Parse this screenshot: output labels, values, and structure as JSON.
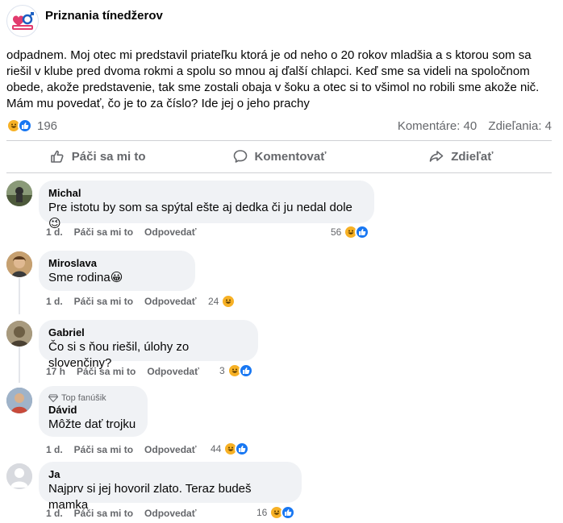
{
  "page": {
    "name": "Priznania tínedžerov",
    "logo_icon": "heart-ring-logo"
  },
  "post": {
    "text": "odpadnem. Moj otec mi predstavil priateľku ktorá je od neho o 20 rokov mladšia a s ktorou som sa riešil v klube pred dvoma rokmi a spolu so mnou aj ďalší chlapci. Keď sme sa videli na spoločnom obede, akože predstavenie, tak sme zostali obaja v šoku a otec si to všimol no robili sme akože nič. Mám mu povedať, čo je to za číslo? Ide jej o jeho prachy",
    "reactions_count": "196",
    "comments_label": "Komentáre: 40",
    "shares_label": "Zdieľania: 4"
  },
  "actions": {
    "like": "Páči sa mi to",
    "comment": "Komentovať",
    "share": "Zdieľať"
  },
  "comments": [
    {
      "name": "Michal",
      "text": "Pre istotu by som sa spýtal ešte aj dedka či ju nedal dole 😉",
      "time": "1 d.",
      "like": "Páči sa mi to",
      "reply": "Odpovedať",
      "count": "56",
      "badge": ""
    },
    {
      "name": "Miroslava",
      "text": "Sme rodina😀",
      "time": "1 d.",
      "like": "Páči sa mi to",
      "reply": "Odpovedať",
      "count": "24",
      "badge": ""
    },
    {
      "name": "Gabriel",
      "text": "Čo si s ňou riešil, úlohy zo slovenčiny?",
      "time": "17 h",
      "like": "Páči sa mi to",
      "reply": "Odpovedať",
      "count": "3",
      "badge": ""
    },
    {
      "name": "Dávid",
      "text": "Môžte dať trojku",
      "time": "1 d.",
      "like": "Páči sa mi to",
      "reply": "Odpovedať",
      "count": "44",
      "badge": "Top fanúšik"
    },
    {
      "name": "Ja",
      "text": "Najprv si jej hovoril zlato. Teraz budeš mamka",
      "time": "1 d.",
      "like": "Páči sa mi to",
      "reply": "Odpovedať",
      "count": "16",
      "badge": ""
    }
  ],
  "colors": {
    "like_blue": "#1877f2",
    "haha_yellow": "#f7b125",
    "muted": "#65676b",
    "bubble": "#f0f2f5"
  }
}
